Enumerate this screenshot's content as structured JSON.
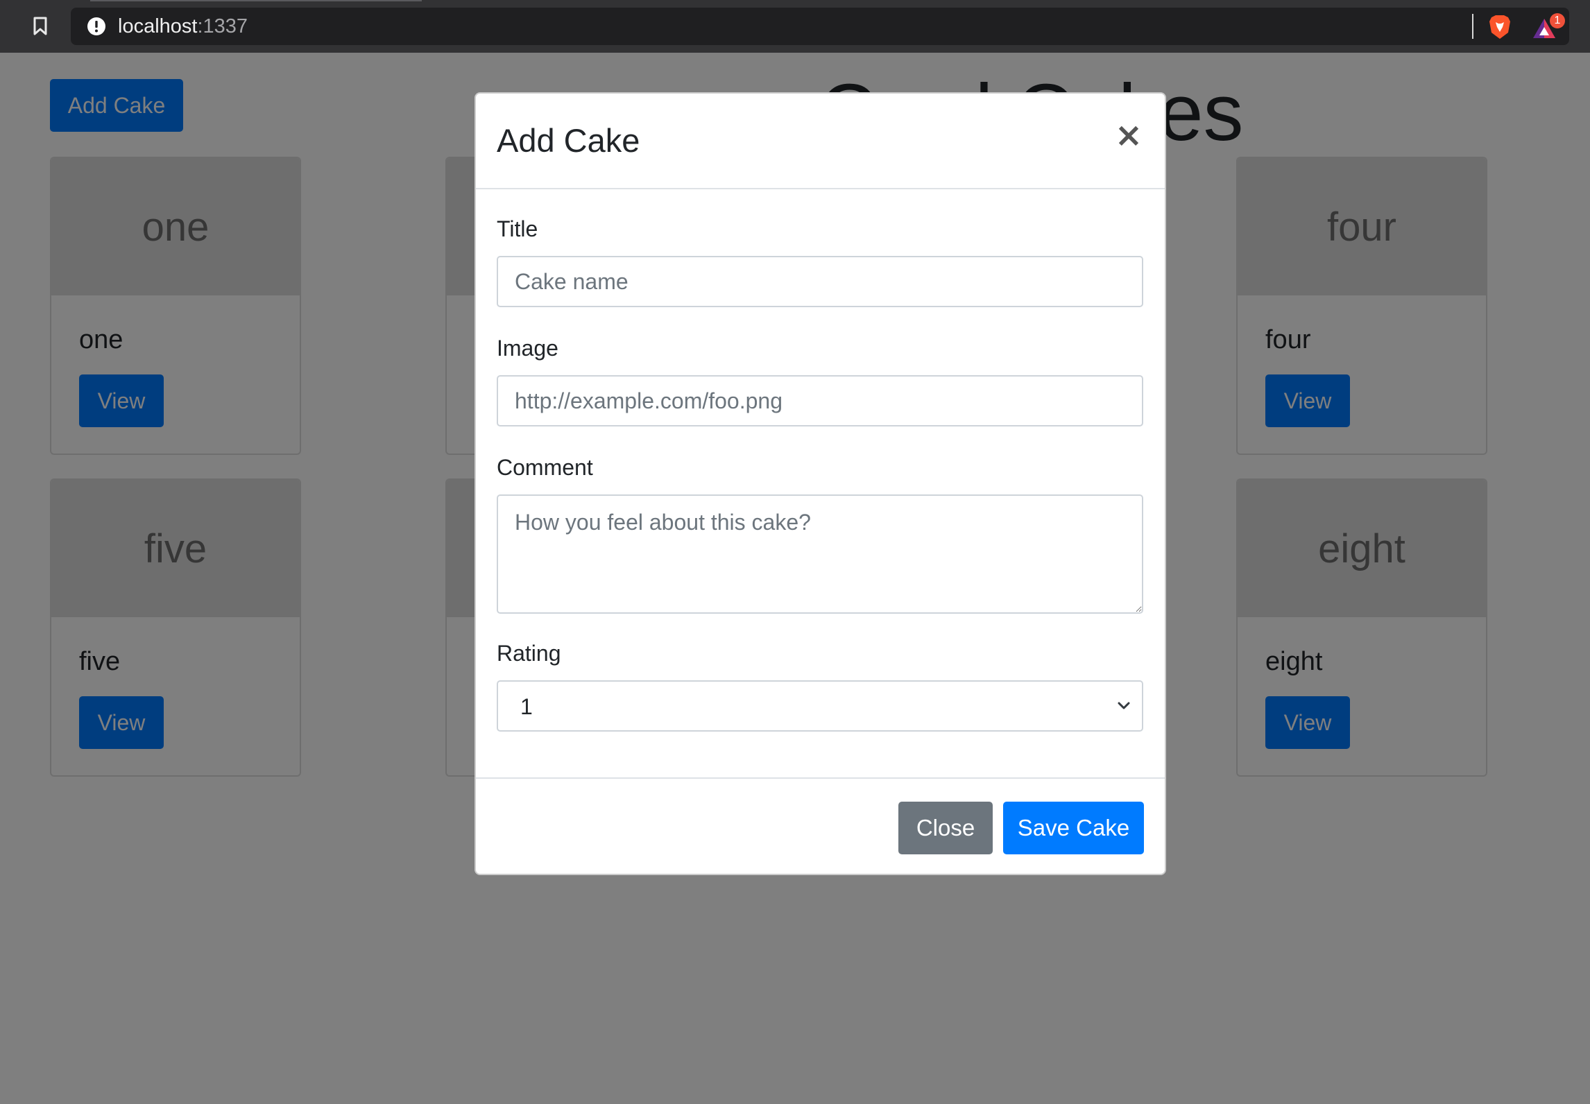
{
  "browser": {
    "url_host": "localhost",
    "url_port": ":1337",
    "rewards_count": "1"
  },
  "page": {
    "title": "Crud Cakes",
    "add_button_label": "Add Cake",
    "cards": [
      {
        "image_text": "one",
        "title": "one",
        "button_label": "View"
      },
      {
        "image_text": "four",
        "title": "four",
        "button_label": "View"
      },
      {
        "image_text": "five",
        "title": "five",
        "button_label": "View"
      },
      {
        "image_text": "eight",
        "title": "eight",
        "button_label": "View"
      }
    ]
  },
  "modal": {
    "title": "Add Cake",
    "close_symbol": "×",
    "fields": {
      "title": {
        "label": "Title",
        "placeholder": "Cake name",
        "value": ""
      },
      "image": {
        "label": "Image",
        "placeholder": "http://example.com/foo.png",
        "value": ""
      },
      "comment": {
        "label": "Comment",
        "placeholder": "How you feel about this cake?",
        "value": ""
      },
      "rating": {
        "label": "Rating",
        "value": "1"
      }
    },
    "close_button_label": "Close",
    "save_button_label": "Save Cake"
  },
  "icons": {
    "bookmark": "bookmark-icon",
    "site_info": "info-icon",
    "brave": "brave-shield-icon",
    "rewards": "rewards-triangle-icon",
    "close": "close-icon",
    "chevron": "chevron-down-icon"
  },
  "colors": {
    "primary": "#007bff",
    "secondary": "#6c757d",
    "backdrop": "rgba(0,0,0,0.5)",
    "brave_orange": "#fb542b"
  }
}
